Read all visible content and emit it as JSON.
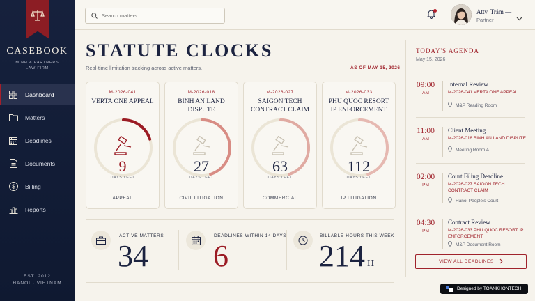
{
  "sidebar": {
    "brand": "CASEBOOK",
    "brand_sub_1": "MINH & PARTNERS",
    "brand_sub_2": "LAW FIRM",
    "items": [
      {
        "label": "Dashboard",
        "icon": "grid-icon"
      },
      {
        "label": "Matters",
        "icon": "folder-icon"
      },
      {
        "label": "Deadlines",
        "icon": "calendar-icon"
      },
      {
        "label": "Documents",
        "icon": "document-icon"
      },
      {
        "label": "Billing",
        "icon": "dollar-icon"
      },
      {
        "label": "Reports",
        "icon": "bar-chart-icon"
      }
    ],
    "est": "EST. 2012",
    "location": "HANOI · VIETNAM"
  },
  "topbar": {
    "search_placeholder": "Search matters...",
    "user_name": "Atty. Trâm —",
    "user_role": "Partner"
  },
  "main": {
    "title": "STATUTE CLOCKS",
    "subtitle": "Real-time limitation tracking across active matters.",
    "as_of": "AS OF MAY 15, 2026",
    "clocks": [
      {
        "code": "M-2026-041",
        "name": "VERTA ONE APPEAL",
        "days": "9",
        "days_label": "DAYS LEFT",
        "category": "APPEAL",
        "fraction": 0.2,
        "color": "#9b1b24"
      },
      {
        "code": "M-2026-018",
        "name": "BINH AN LAND DISPUTE",
        "days": "27",
        "days_label": "DAYS LEFT",
        "category": "CIVIL LITIGATION",
        "fraction": 0.45,
        "color": "#d88c84"
      },
      {
        "code": "M-2026-027",
        "name": "SAIGON TECH CONTRACT CLAIM",
        "days": "63",
        "days_label": "DAYS LEFT",
        "category": "COMMERCIAL",
        "fraction": 0.45,
        "color": "#e0aaa2"
      },
      {
        "code": "M-2026-033",
        "name": "PHU QUOC RESORT IP ENFORCEMENT",
        "days": "112",
        "days_label": "DAYS LEFT",
        "category": "IP LITIGATION",
        "fraction": 0.45,
        "color": "#e6b8b1"
      }
    ],
    "stats": [
      {
        "label": "ACTIVE MATTERS",
        "value": "34",
        "unit": "",
        "icon": "briefcase-icon"
      },
      {
        "label": "DEADLINES WITHIN 14 DAYS",
        "value": "6",
        "unit": "",
        "icon": "calendar-icon"
      },
      {
        "label": "BILLABLE HOURS THIS WEEK",
        "value": "214",
        "unit": "H",
        "icon": "clock-icon"
      }
    ]
  },
  "agenda": {
    "title": "TODAY'S AGENDA",
    "date": "May 15, 2026",
    "events": [
      {
        "time": "09:00",
        "ampm": "AM",
        "title": "Internal Review",
        "matter": "M-2026-041 VERTA ONE APPEAL",
        "location": "M&P Reading Room"
      },
      {
        "time": "11:00",
        "ampm": "AM",
        "title": "Client Meeting",
        "matter": "M-2026-018 BINH AN LAND DISPUTE",
        "location": "Meeting Room A"
      },
      {
        "time": "02:00",
        "ampm": "PM",
        "title": "Court Filing Deadline",
        "matter": "M-2026-027 SAIGON TECH CONTRACT CLAIM",
        "location": "Hanoi People's Court"
      },
      {
        "time": "04:30",
        "ampm": "PM",
        "title": "Contract Review",
        "matter": "M-2026-033 PHU QUOC RESORT IP ENFORCEMENT",
        "location": "M&P Document Room"
      }
    ],
    "view_all": "VIEW ALL DEADLINES"
  },
  "credit": "Designed by TOANKHONTECH",
  "colors": {
    "accent": "#a0232c",
    "navy": "#16213d",
    "paper": "#f6f3ec"
  }
}
